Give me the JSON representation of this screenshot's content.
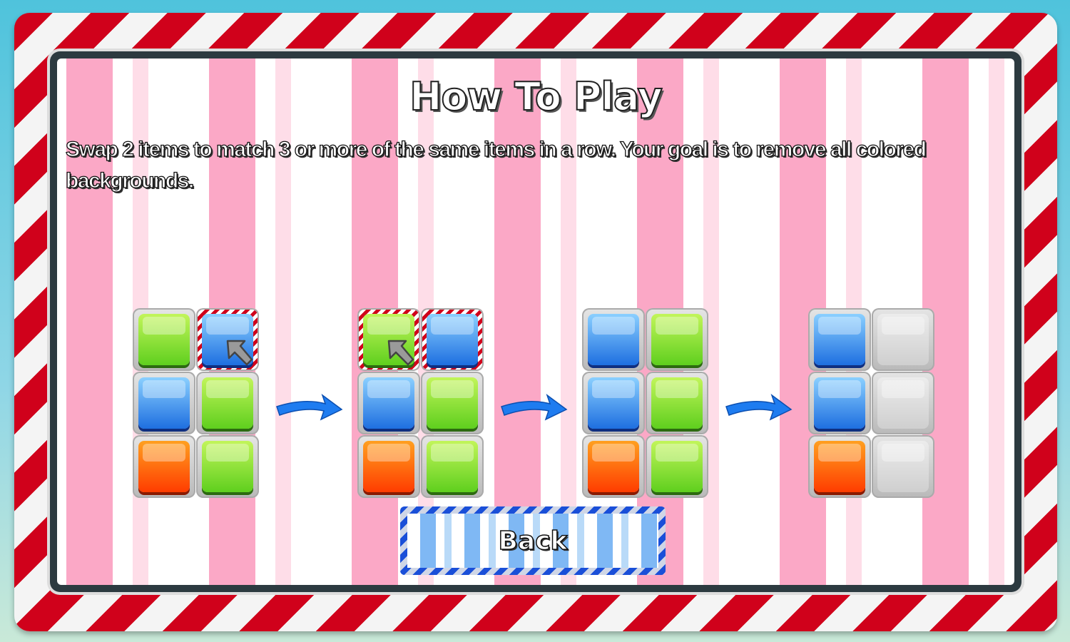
{
  "title": "How To Play",
  "description": "Swap 2 items to match 3 or more of the same items in a row. Your goal is to remove all colored backgrounds.",
  "back_label": "Back",
  "steps": [
    {
      "cells": [
        "green",
        "blue",
        "blue",
        "green",
        "orange",
        "green"
      ],
      "selected": [
        1
      ],
      "cursor": 1
    },
    {
      "cells": [
        "green",
        "blue",
        "blue",
        "green",
        "orange",
        "green"
      ],
      "selected": [
        0,
        1
      ],
      "cursor": 0
    },
    {
      "cells": [
        "blue",
        "green",
        "blue",
        "green",
        "orange",
        "green"
      ],
      "selected": [],
      "cursor": null
    },
    {
      "cells": [
        "blue",
        "empty",
        "blue",
        "empty",
        "orange",
        "empty"
      ],
      "selected": [],
      "cursor": null
    }
  ],
  "colors": {
    "frame_red": "#d0011b",
    "stripe_pink": "#fba8c6",
    "button_blue": "#1a4fd8",
    "arrow_blue": "#1e7cf0"
  },
  "icons": {
    "cursor": "arrow-up-left-icon",
    "step_arrow": "curved-arrow-right-icon"
  }
}
